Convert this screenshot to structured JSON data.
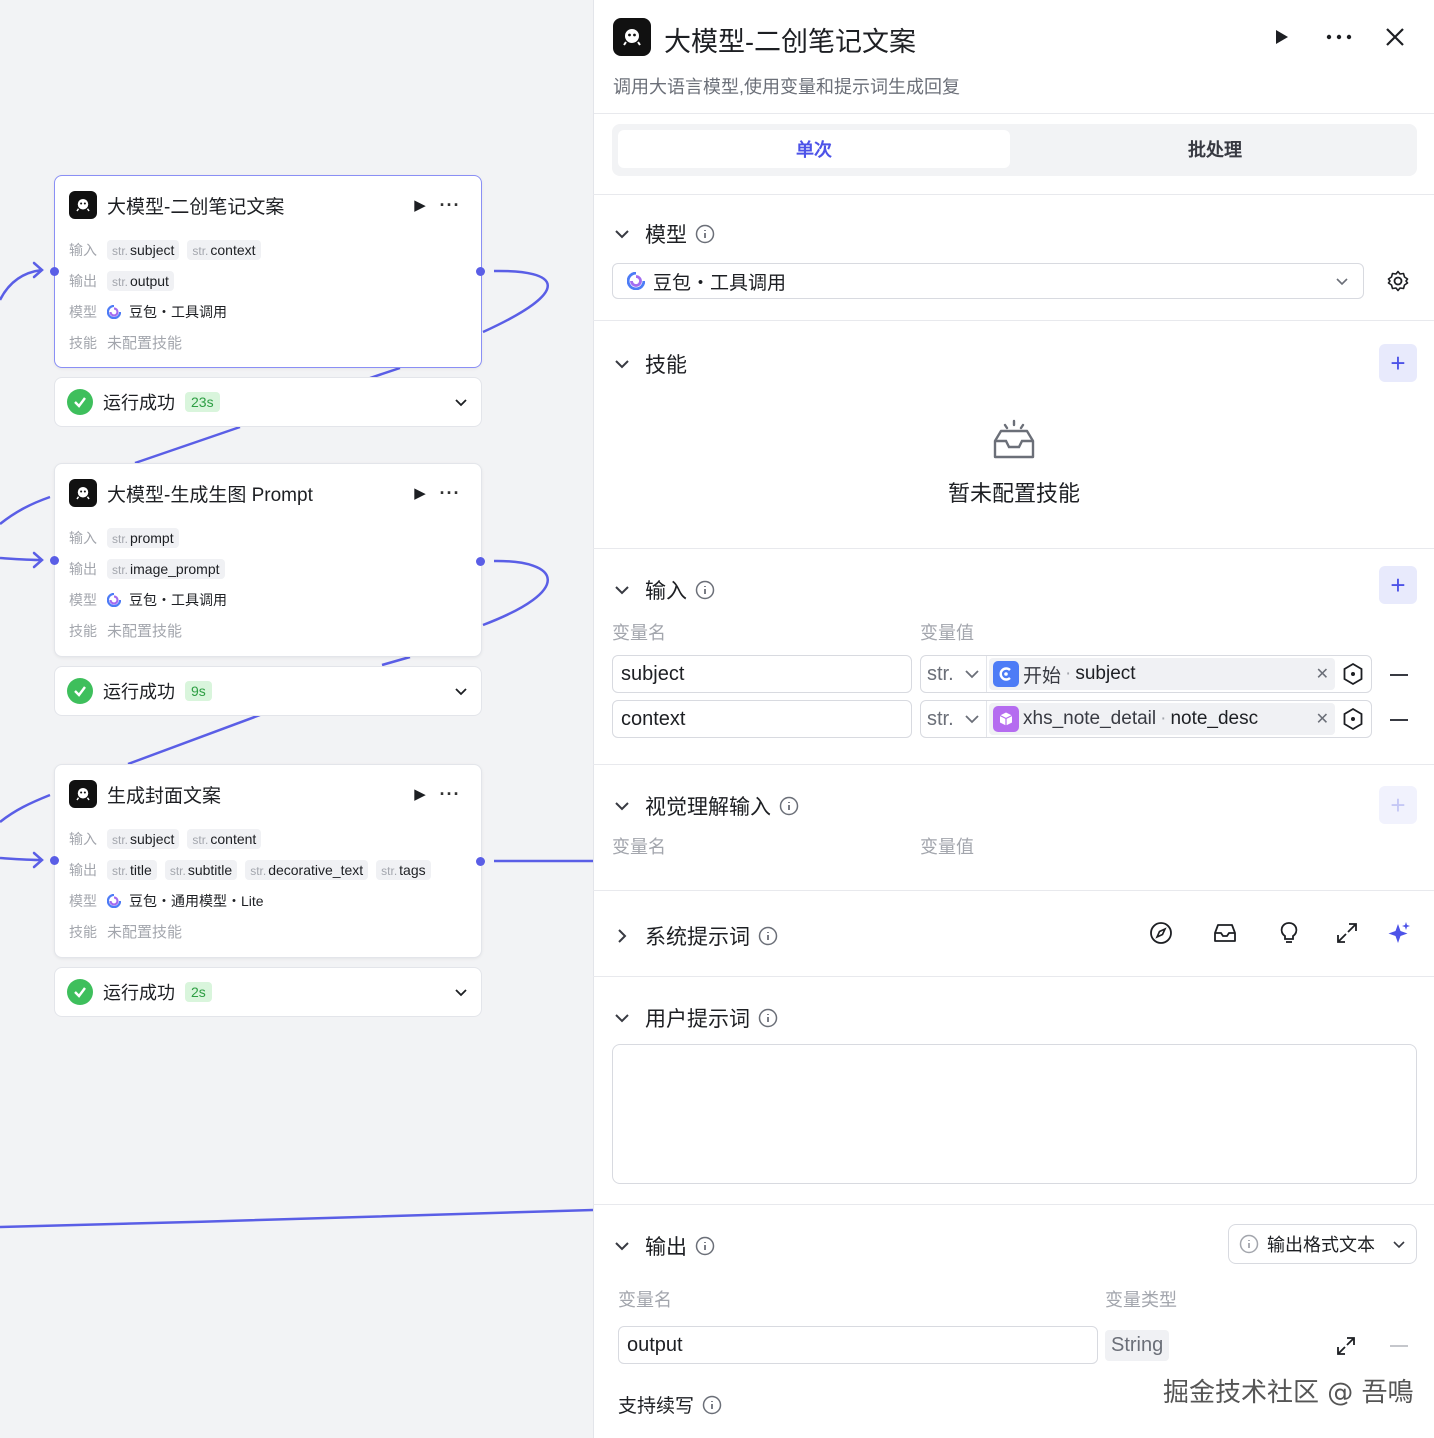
{
  "canvas": {
    "nodes": [
      {
        "title": "大模型-二创笔记文案",
        "input_label": "输入",
        "inputs": [
          "subject",
          "context"
        ],
        "output_label": "输出",
        "outputs": [
          "output"
        ],
        "model_label": "模型",
        "model": "豆包・工具调用",
        "skill_label": "技能",
        "skill": "未配置技能",
        "status": "运行成功",
        "duration": "23s"
      },
      {
        "title": "大模型-生成生图 Prompt",
        "input_label": "输入",
        "inputs": [
          "prompt"
        ],
        "output_label": "输出",
        "outputs": [
          "image_prompt"
        ],
        "model_label": "模型",
        "model": "豆包・工具调用",
        "skill_label": "技能",
        "skill": "未配置技能",
        "status": "运行成功",
        "duration": "9s"
      },
      {
        "title": "生成封面文案",
        "input_label": "输入",
        "inputs": [
          "subject",
          "content"
        ],
        "output_label": "输出",
        "outputs": [
          "title",
          "subtitle",
          "decorative_text",
          "tags"
        ],
        "model_label": "模型",
        "model": "豆包・通用模型・Lite",
        "skill_label": "技能",
        "skill": "未配置技能",
        "status": "运行成功",
        "duration": "2s"
      }
    ],
    "type_prefix": "str."
  },
  "panel": {
    "title": "大模型-二创笔记文案",
    "description": "调用大语言模型,使用变量和提示词生成回复",
    "tabs": [
      "单次",
      "批处理"
    ],
    "model_section": {
      "label": "模型",
      "selected": "豆包・工具调用"
    },
    "skills_section": {
      "label": "技能",
      "empty_text": "暂未配置技能"
    },
    "input_section": {
      "label": "输入",
      "col_name": "变量名",
      "col_value": "变量值",
      "rows": [
        {
          "name": "subject",
          "type": "str.",
          "source": "开始",
          "field": "subject"
        },
        {
          "name": "context",
          "type": "str.",
          "source": "xhs_note_detail",
          "field": "note_desc"
        }
      ]
    },
    "vision_section": {
      "label": "视觉理解输入",
      "col_name": "变量名",
      "col_value": "变量值"
    },
    "system_prompt": {
      "label": "系统提示词"
    },
    "user_prompt": {
      "label": "用户提示词",
      "value": ""
    },
    "output_section": {
      "label": "输出",
      "format": "输出格式文本",
      "col_name": "变量名",
      "col_type": "变量类型",
      "rows": [
        {
          "name": "output",
          "type": "String"
        }
      ],
      "continue_label": "支持续写"
    }
  },
  "watermark": "掘金技术社区 @ 吾鳴",
  "colors": {
    "accent": "#4d53e8",
    "success": "#3ebf5c",
    "edge": "#5a5ee6"
  }
}
